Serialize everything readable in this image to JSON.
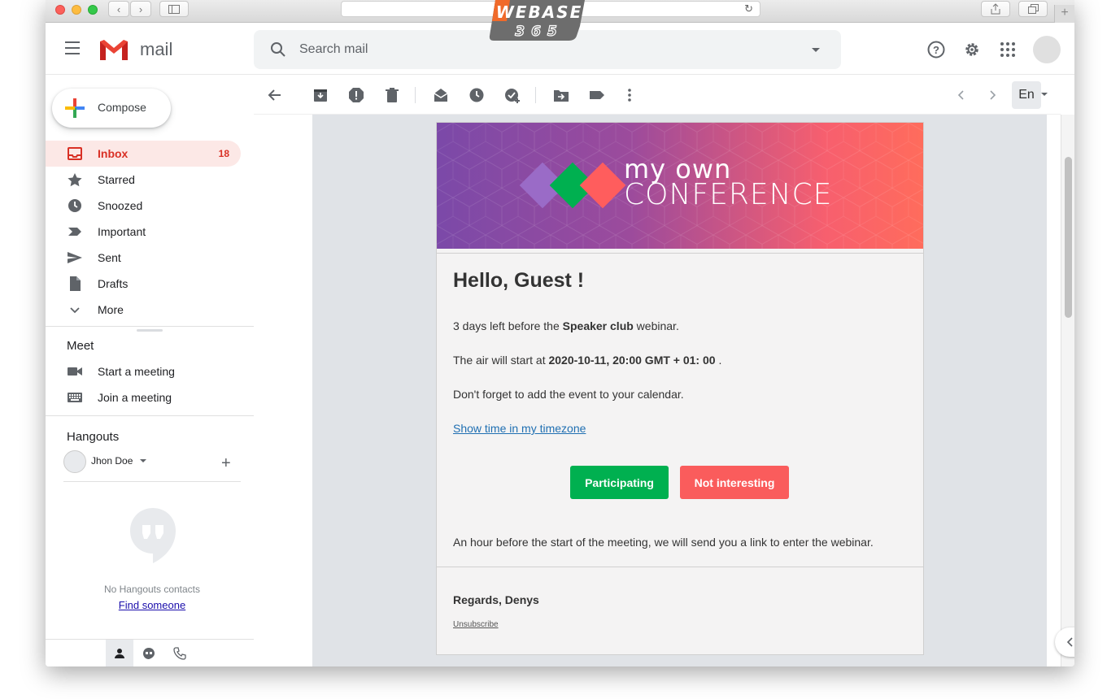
{
  "browser": {
    "watermark_line1": "WEBASE",
    "watermark_line2": "365"
  },
  "header": {
    "app_name": "mail",
    "search_placeholder": "Search mail"
  },
  "sidebar": {
    "compose_label": "Compose",
    "items": [
      {
        "label": "Inbox",
        "count": "18",
        "icon": "inbox-icon"
      },
      {
        "label": "Starred",
        "icon": "star-icon"
      },
      {
        "label": "Snoozed",
        "icon": "clock-icon"
      },
      {
        "label": "Important",
        "icon": "important-icon"
      },
      {
        "label": "Sent",
        "icon": "send-icon"
      },
      {
        "label": "Drafts",
        "icon": "file-icon"
      },
      {
        "label": "More",
        "icon": "chevron-down-icon"
      }
    ],
    "meet": {
      "title": "Meet",
      "items": [
        {
          "label": "Start a meeting",
          "icon": "video-icon"
        },
        {
          "label": "Join a meeting",
          "icon": "keyboard-icon"
        }
      ]
    },
    "hangouts": {
      "title": "Hangouts",
      "user": "Jhon Doe",
      "empty_text": "No Hangouts contacts",
      "find_link": "Find someone"
    }
  },
  "toolbar": {
    "language": "En"
  },
  "email": {
    "banner_line1": "my own",
    "banner_line2": "CONFERENCE",
    "greeting": "Hello, Guest !",
    "p1_pre": "3 days left before the ",
    "p1_bold": "Speaker club",
    "p1_post": " webinar.",
    "p2_pre": "The air will start at ",
    "p2_bold": "2020-10-11, 20:00 GMT + 01: 00",
    "p2_post": " .",
    "p3": "Don't forget to add the event to your calendar.",
    "timezone_link": "Show time in my timezone",
    "btn_yes": "Participating",
    "btn_no": "Not interesting",
    "p4": "An hour before the start of the meeting, we will send you a link to enter the webinar.",
    "regards": "Regards, Denys",
    "unsubscribe": "Unsubscribe"
  },
  "colors": {
    "accent_red": "#d93025",
    "participate_green": "#00b050",
    "decline_red": "#fa5c5c",
    "banner_purple": "#7b49a8",
    "banner_coral": "#ff6c5c"
  }
}
